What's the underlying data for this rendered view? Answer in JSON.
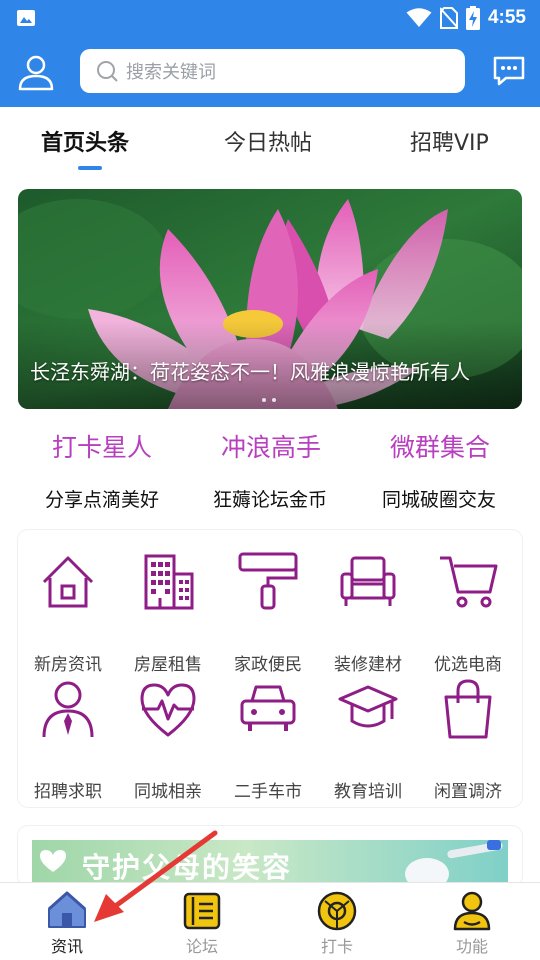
{
  "status_bar": {
    "time": "4:55"
  },
  "header": {
    "search_placeholder": "搜索关键词"
  },
  "tabs": [
    {
      "label": "首页头条",
      "active": true
    },
    {
      "label": "今日热帖",
      "active": false
    },
    {
      "label": "招聘VIP",
      "active": false
    }
  ],
  "banner": {
    "caption": "长泾东舜湖：荷花姿态不一！风雅浪漫惊艳所有人"
  },
  "highlights": [
    {
      "title": "打卡星人",
      "subtitle": "分享点滴美好"
    },
    {
      "title": "冲浪高手",
      "subtitle": "狂薅论坛金币"
    },
    {
      "title": "微群集合",
      "subtitle": "同城破圈交友"
    }
  ],
  "services": [
    {
      "label": "新房资讯",
      "icon": "house-icon"
    },
    {
      "label": "房屋租售",
      "icon": "building-icon"
    },
    {
      "label": "家政便民",
      "icon": "paint-roller-icon"
    },
    {
      "label": "装修建材",
      "icon": "armchair-icon"
    },
    {
      "label": "优选电商",
      "icon": "shopping-cart-icon"
    },
    {
      "label": "招聘求职",
      "icon": "person-tie-icon"
    },
    {
      "label": "同城相亲",
      "icon": "heartbeat-icon"
    },
    {
      "label": "二手车市",
      "icon": "car-icon"
    },
    {
      "label": "教育培训",
      "icon": "graduation-cap-icon"
    },
    {
      "label": "闲置调济",
      "icon": "shopping-bag-icon"
    }
  ],
  "promo": {
    "text": "守护父母的笑容"
  },
  "bottom_nav": [
    {
      "label": "资讯",
      "icon": "home-icon",
      "active": true
    },
    {
      "label": "论坛",
      "icon": "forum-icon",
      "active": false
    },
    {
      "label": "打卡",
      "icon": "checkin-icon",
      "active": false
    },
    {
      "label": "功能",
      "icon": "person-icon",
      "active": false
    }
  ],
  "colors": {
    "primary": "#2f86e8",
    "accent": "#b83fbf",
    "icon": "#8e1e86",
    "nav": "#f1c40f"
  }
}
